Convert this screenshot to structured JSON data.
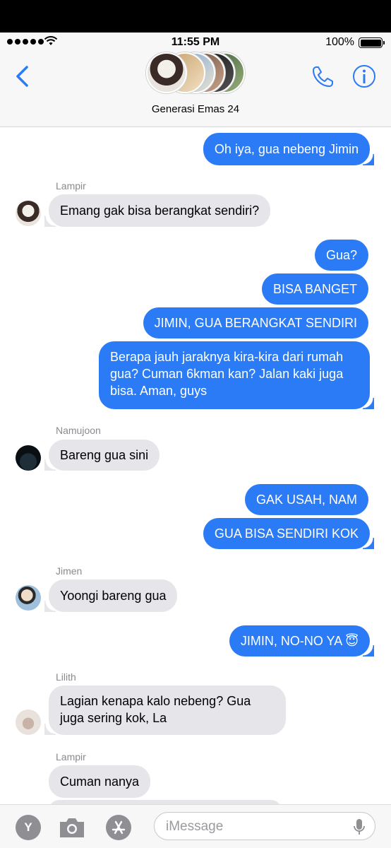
{
  "status": {
    "time": "11:55 PM",
    "battery": "100%"
  },
  "header": {
    "group_name": "Generasi Emas 24"
  },
  "messages": [
    {
      "type": "sent",
      "text": "Oh iya, gua nebeng Jimin"
    },
    {
      "type": "recv",
      "sender": "Lampir",
      "text": "Emang gak bisa berangkat sendiri?"
    },
    {
      "type": "sent",
      "text": "Gua?"
    },
    {
      "type": "sent",
      "text": "BISA BANGET"
    },
    {
      "type": "sent",
      "text": "JIMIN, GUA BERANGKAT SENDIRI"
    },
    {
      "type": "sent",
      "text": "Berapa jauh jaraknya kira-kira dari rumah gua? Cuman 6kman kan? Jalan kaki juga bisa. Aman, guys"
    },
    {
      "type": "recv",
      "sender": "Namujoon",
      "text": "Bareng gua sini"
    },
    {
      "type": "sent",
      "text": "GAK USAH, NAM"
    },
    {
      "type": "sent",
      "text": "GUA BISA SENDIRI KOK"
    },
    {
      "type": "recv",
      "sender": "Jimen",
      "text": "Yoongi bareng gua"
    },
    {
      "type": "sent",
      "text": "JIMIN, NO-NO YA 😇"
    },
    {
      "type": "recv",
      "sender": "Lilith",
      "text": "Lagian kenapa kalo nebeng? Gua juga sering kok, La"
    },
    {
      "type": "recv",
      "sender": "Lampir",
      "text": "Cuman nanya"
    }
  ],
  "composer": {
    "placeholder": "iMessage",
    "apps_label": "Y"
  },
  "colors": {
    "sent_bubble": "#2b7bf6",
    "recv_bubble": "#e6e5ea",
    "accent": "#2b7bf6"
  }
}
